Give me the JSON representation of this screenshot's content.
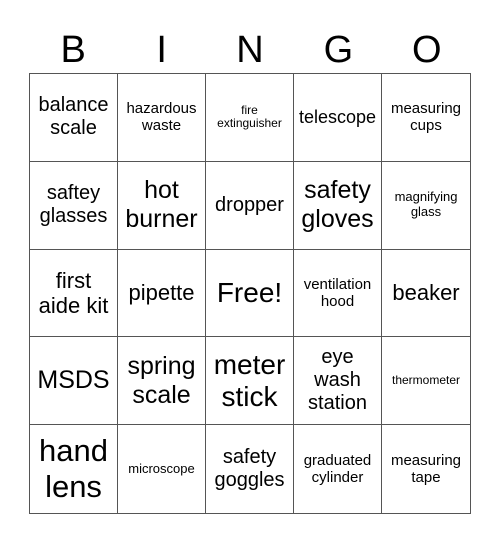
{
  "header": [
    "B",
    "I",
    "N",
    "G",
    "O"
  ],
  "cells": [
    {
      "text": "balance scale",
      "size": "s20"
    },
    {
      "text": "hazardous waste",
      "size": "s14"
    },
    {
      "text": "fire extinguisher",
      "size": "s12"
    },
    {
      "text": "telescope",
      "size": "s17"
    },
    {
      "text": "measuring cups",
      "size": "s14"
    },
    {
      "text": "saftey glasses",
      "size": "s20"
    },
    {
      "text": "hot burner",
      "size": "s24"
    },
    {
      "text": "dropper",
      "size": "s20"
    },
    {
      "text": "safety gloves",
      "size": "s24"
    },
    {
      "text": "magnifying glass",
      "size": "s13"
    },
    {
      "text": "first aide kit",
      "size": "s22"
    },
    {
      "text": "pipette",
      "size": "s22"
    },
    {
      "text": "Free!",
      "size": "s28"
    },
    {
      "text": "ventilation hood",
      "size": "s14"
    },
    {
      "text": "beaker",
      "size": "s22"
    },
    {
      "text": "MSDS",
      "size": "s24"
    },
    {
      "text": "spring scale",
      "size": "s24"
    },
    {
      "text": "meter stick",
      "size": "s28"
    },
    {
      "text": "eye wash station",
      "size": "s20"
    },
    {
      "text": "thermometer",
      "size": "s12"
    },
    {
      "text": "hand lens",
      "size": "s31"
    },
    {
      "text": "microscope",
      "size": "s13"
    },
    {
      "text": "safety goggles",
      "size": "s20"
    },
    {
      "text": "graduated cylinder",
      "size": "s14"
    },
    {
      "text": "measuring tape",
      "size": "s14"
    }
  ]
}
